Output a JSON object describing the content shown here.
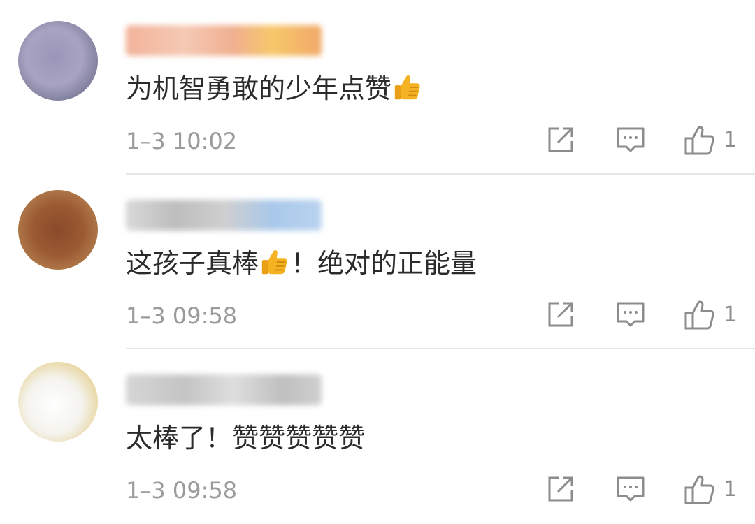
{
  "comments": [
    {
      "content_before": "为机智勇敢的少年点赞",
      "content_after": "",
      "timestamp": "1–3 10:02",
      "like_count": "1"
    },
    {
      "content_before": "这孩子真棒",
      "content_after": "！绝对的正能量",
      "timestamp": "1–3 09:58",
      "like_count": "1"
    },
    {
      "content_before": "太棒了！赞赞赞赞赞",
      "content_after": "",
      "timestamp": "1–3 09:58",
      "like_count": "1"
    }
  ],
  "icons": {
    "share": "share-icon",
    "reply": "comment-icon",
    "like": "thumbs-up-icon",
    "emoji": "thumbs-up-emoji-icon"
  },
  "colors": {
    "text": "#2b2b2b",
    "muted": "#9b9b9b",
    "icon": "#8c8c8c",
    "emoji": "#f5b324"
  }
}
